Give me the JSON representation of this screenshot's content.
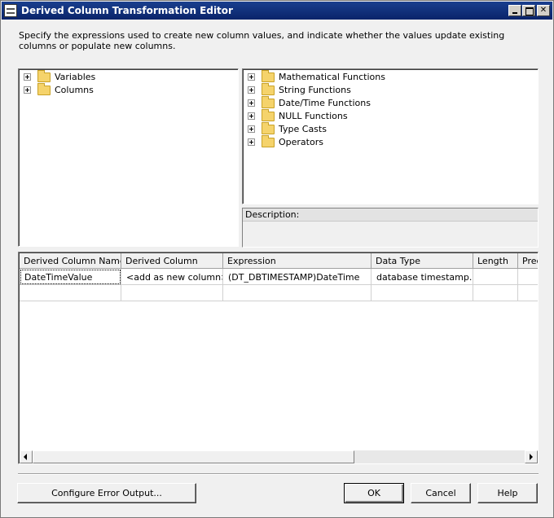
{
  "window": {
    "title": "Derived Column Transformation Editor"
  },
  "instructions": "Specify the expressions used to create new column values, and indicate whether the values update existing columns or populate new columns.",
  "left_tree": [
    {
      "label": "Variables",
      "icon": "folder-icon"
    },
    {
      "label": "Columns",
      "icon": "folder-icon"
    }
  ],
  "right_tree": [
    {
      "label": "Mathematical Functions",
      "icon": "folder-icon"
    },
    {
      "label": "String Functions",
      "icon": "folder-icon"
    },
    {
      "label": "Date/Time Functions",
      "icon": "folder-icon"
    },
    {
      "label": "NULL Functions",
      "icon": "folder-icon"
    },
    {
      "label": "Type Casts",
      "icon": "folder-icon"
    },
    {
      "label": "Operators",
      "icon": "folder-icon"
    }
  ],
  "description": {
    "label": "Description:"
  },
  "grid": {
    "columns": [
      "Derived Column Name",
      "Derived Column",
      "Expression",
      "Data Type",
      "Length",
      "Prec"
    ],
    "rows": [
      [
        "DateTimeValue",
        "<add as new column>",
        "(DT_DBTIMESTAMP)DateTime",
        "database timestamp...",
        "",
        ""
      ]
    ]
  },
  "buttons": {
    "configure_error_output": "Configure Error Output...",
    "ok": "OK",
    "cancel": "Cancel",
    "help": "Help"
  }
}
